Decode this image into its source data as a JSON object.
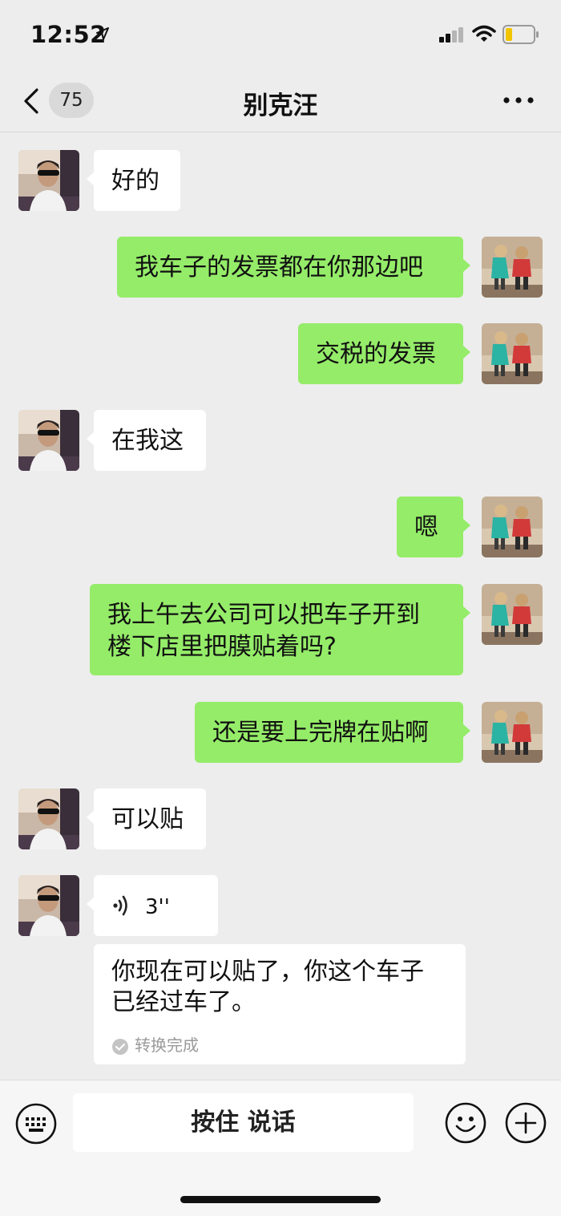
{
  "status_bar": {
    "time": "12:52"
  },
  "nav": {
    "back_count": "75",
    "title": "别克汪"
  },
  "messages": [
    {
      "side": "left",
      "text": "好的"
    },
    {
      "side": "right",
      "text": "我车子的发票都在你那边吧"
    },
    {
      "side": "right",
      "text": "交税的发票"
    },
    {
      "side": "left",
      "text": "在我这"
    },
    {
      "side": "right",
      "text": "嗯"
    },
    {
      "side": "right",
      "text": "我上午去公司可以把车子开到\n楼下店里把膜贴着吗?"
    },
    {
      "side": "right",
      "text": "还是要上完牌在贴啊"
    },
    {
      "side": "left",
      "text": "可以贴"
    }
  ],
  "voice_message": {
    "duration": "3''",
    "transcript": "你现在可以贴了，你这个车子\n已经过车了。",
    "transcript_status": "转换完成"
  },
  "input_bar": {
    "hold_to_talk": "按住 说话"
  },
  "colors": {
    "background": "#ededed",
    "sent_bubble": "#95ec69",
    "received_bubble": "#ffffff"
  }
}
